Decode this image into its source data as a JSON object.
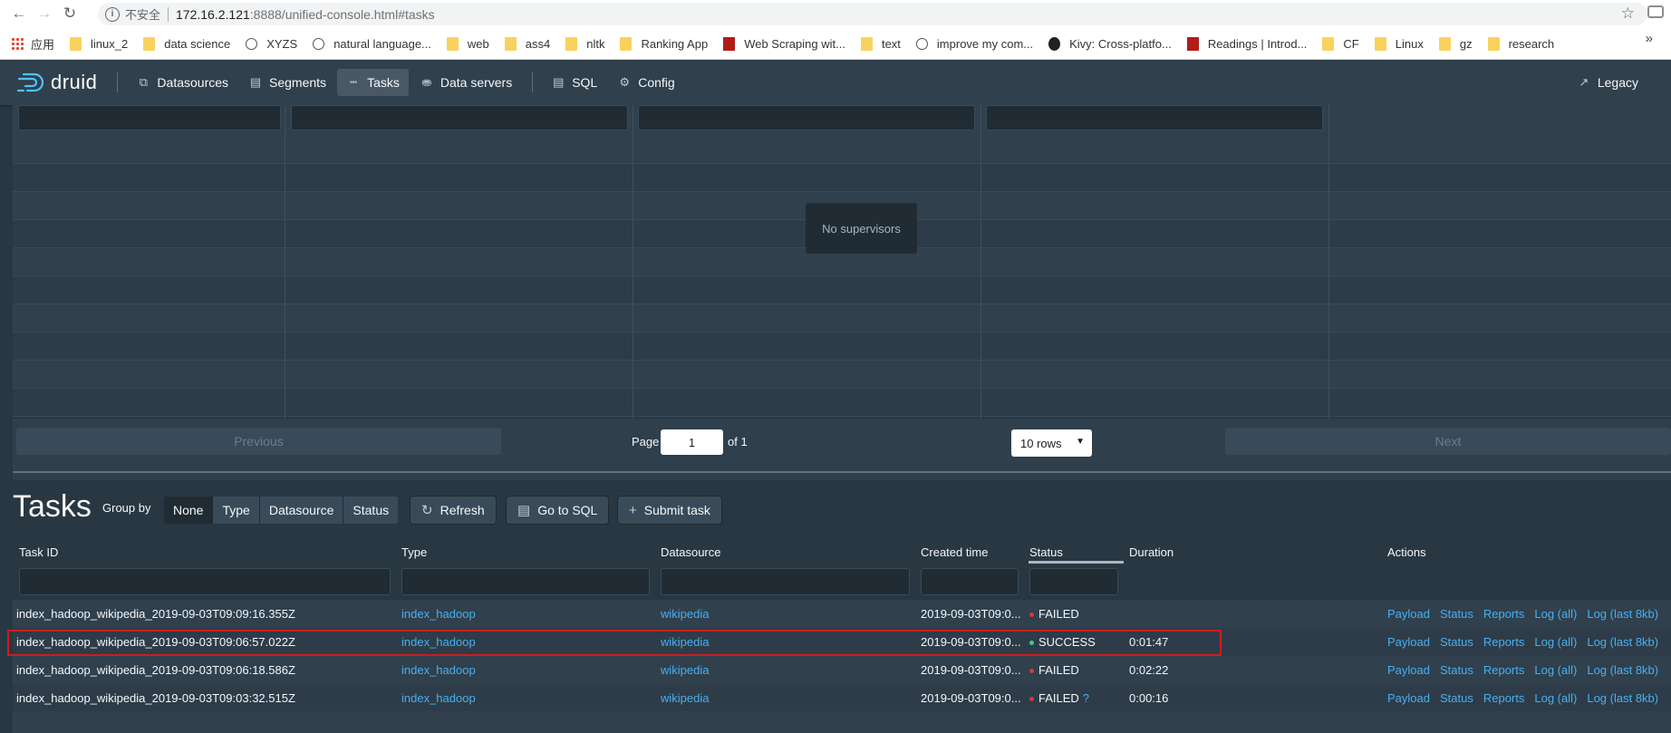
{
  "browser": {
    "security_label": "不安全",
    "url_host": "172.16.2.121",
    "url_rest": ":8888/unified-console.html#tasks",
    "bookmarks": [
      {
        "label": "应用",
        "icon": "apps-icon"
      },
      {
        "label": "linux_2",
        "icon": "folder-icon"
      },
      {
        "label": "data science",
        "icon": "folder-icon"
      },
      {
        "label": "XYZS",
        "icon": "globe-icon"
      },
      {
        "label": "natural language...",
        "icon": "globe-icon"
      },
      {
        "label": "web",
        "icon": "folder-icon"
      },
      {
        "label": "ass4",
        "icon": "folder-icon"
      },
      {
        "label": "nltk",
        "icon": "folder-icon"
      },
      {
        "label": "Ranking App",
        "icon": "folder-icon"
      },
      {
        "label": "Web Scraping wit...",
        "icon": "stanford-icon"
      },
      {
        "label": "text",
        "icon": "folder-icon"
      },
      {
        "label": "improve my com...",
        "icon": "globe-icon"
      },
      {
        "label": "Kivy: Cross-platfo...",
        "icon": "kivy-icon"
      },
      {
        "label": "Readings | Introd...",
        "icon": "mit-icon"
      },
      {
        "label": "CF",
        "icon": "folder-icon"
      },
      {
        "label": "Linux",
        "icon": "folder-icon"
      },
      {
        "label": "gz",
        "icon": "folder-icon"
      },
      {
        "label": "research",
        "icon": "folder-icon"
      }
    ]
  },
  "nav": {
    "logo": "druid",
    "items": [
      {
        "label": "Datasources",
        "icon": "datasources-icon"
      },
      {
        "label": "Segments",
        "icon": "segments-icon"
      },
      {
        "label": "Tasks",
        "icon": "tasks-icon",
        "active": true
      },
      {
        "label": "Data servers",
        "icon": "database-icon"
      },
      {
        "label": "SQL",
        "icon": "sql-icon"
      },
      {
        "label": "Config",
        "icon": "config-icon"
      }
    ],
    "legacy": "Legacy"
  },
  "supervisors": {
    "empty_message": "No supervisors",
    "previous": "Previous",
    "next": "Next",
    "page_label": "Page",
    "page_value": "1",
    "of_label": "of 1",
    "rows_select": "10 rows"
  },
  "tasks": {
    "title": "Tasks",
    "group_by_label": "Group by",
    "group_options": [
      "None",
      "Type",
      "Datasource",
      "Status"
    ],
    "refresh": "Refresh",
    "go_to_sql": "Go to SQL",
    "submit_task": "Submit task",
    "columns": [
      "Task ID",
      "Type",
      "Datasource",
      "Created time",
      "Status",
      "Duration",
      "Actions"
    ],
    "action_links": [
      "Payload",
      "Status",
      "Reports",
      "Log (all)",
      "Log (last 8kb)"
    ],
    "rows": [
      {
        "task_id": "index_hadoop_wikipedia_2019-09-03T09:09:16.355Z",
        "type": "index_hadoop",
        "datasource": "wikipedia",
        "created": "2019-09-03T09:0...",
        "status": "FAILED",
        "status_color": "#db3737",
        "duration": "",
        "help": ""
      },
      {
        "task_id": "index_hadoop_wikipedia_2019-09-03T09:06:57.022Z",
        "type": "index_hadoop",
        "datasource": "wikipedia",
        "created": "2019-09-03T09:0...",
        "status": "SUCCESS",
        "status_color": "#3dcc91",
        "duration": "0:01:47",
        "help": ""
      },
      {
        "task_id": "index_hadoop_wikipedia_2019-09-03T09:06:18.586Z",
        "type": "index_hadoop",
        "datasource": "wikipedia",
        "created": "2019-09-03T09:0...",
        "status": "FAILED",
        "status_color": "#db3737",
        "duration": "0:02:22",
        "help": ""
      },
      {
        "task_id": "index_hadoop_wikipedia_2019-09-03T09:03:32.515Z",
        "type": "index_hadoop",
        "datasource": "wikipedia",
        "created": "2019-09-03T09:0...",
        "status": "FAILED",
        "status_color": "#db3737",
        "duration": "0:00:16",
        "help": "?"
      }
    ]
  }
}
